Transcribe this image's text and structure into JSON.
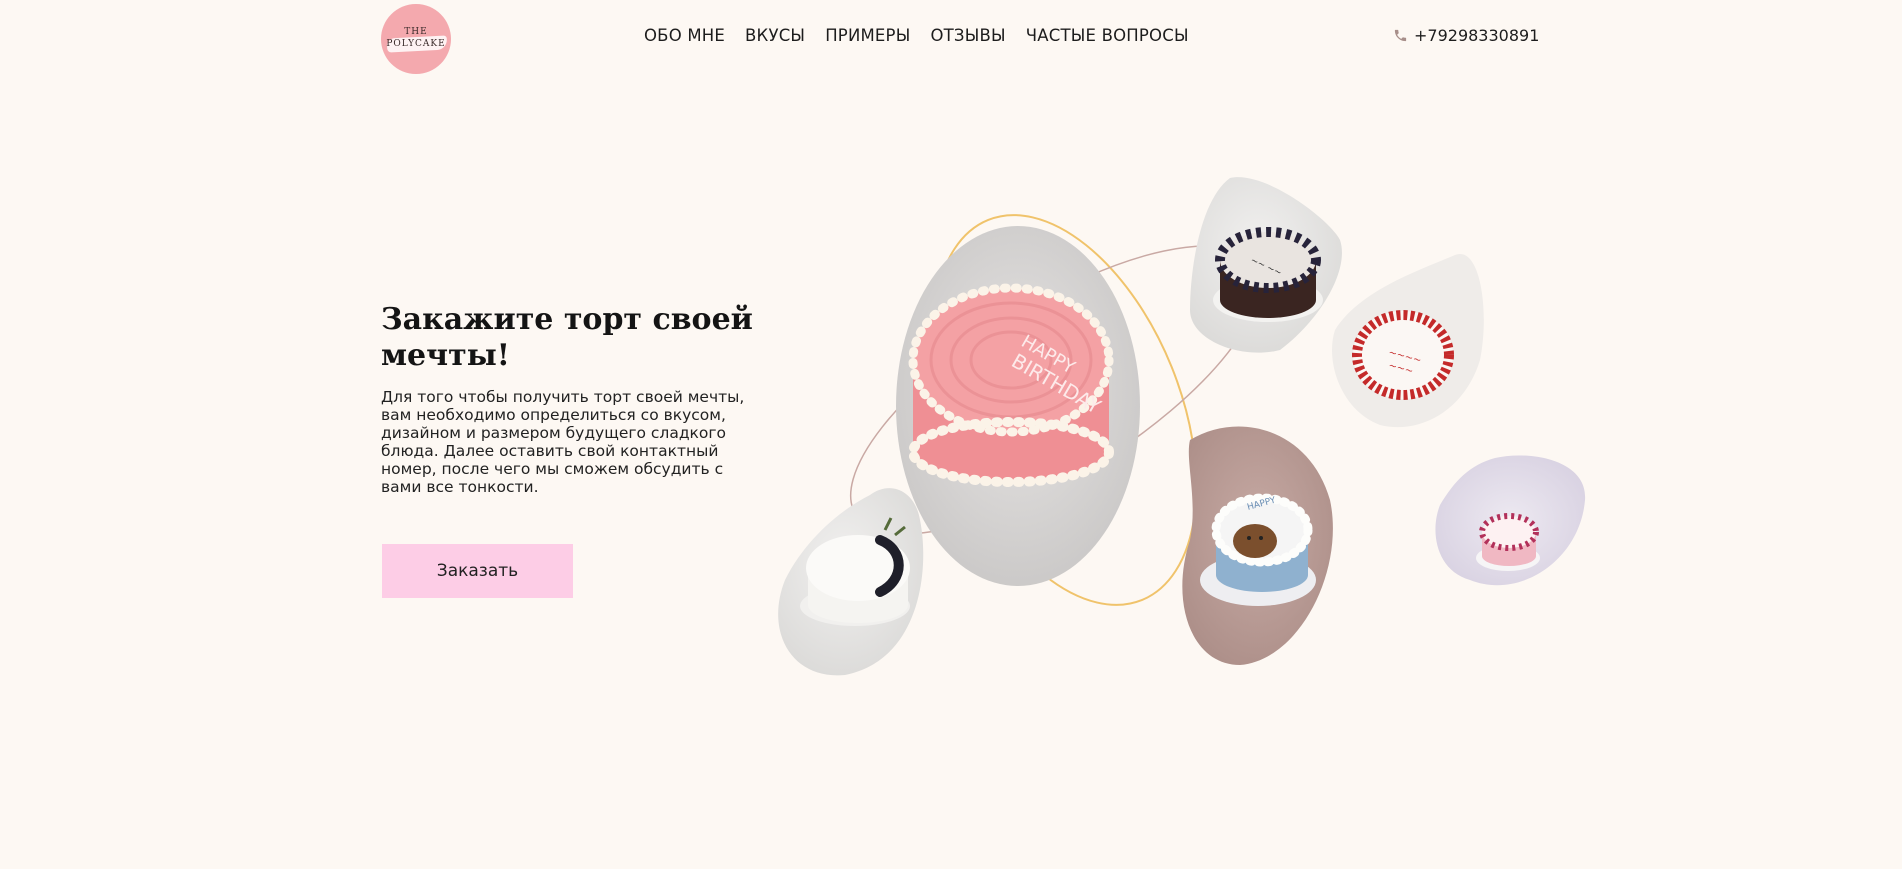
{
  "header": {
    "logo": {
      "line1": "THE",
      "line2": "POLYCAKE"
    },
    "nav": [
      {
        "label": "ОБО МНЕ"
      },
      {
        "label": "ВКУСЫ"
      },
      {
        "label": "ПРИМЕРЫ"
      },
      {
        "label": "ОТЗЫВЫ"
      },
      {
        "label": "ЧАСТЫЕ ВОПРОСЫ"
      }
    ],
    "phone": "+79298330891",
    "phone_icon": "phone-icon"
  },
  "hero": {
    "title_line1": "Закажите торт своей",
    "title_line2": "мечты!",
    "text": "Для того чтобы получить торт своей мечты, вам необходимо определиться со вкусом, дизайном и размером будущего сладкого блюда. Далее оставить свой контактный номер, после чего мы сможем обсудить с вами все тонкости.",
    "button": "Заказать"
  },
  "colors": {
    "background": "#fdf8f3",
    "button": "#fdcde6",
    "logo": "#f4a9ae",
    "orbit_gold": "#f0c36b",
    "orbit_brown": "#c9a9a4"
  }
}
